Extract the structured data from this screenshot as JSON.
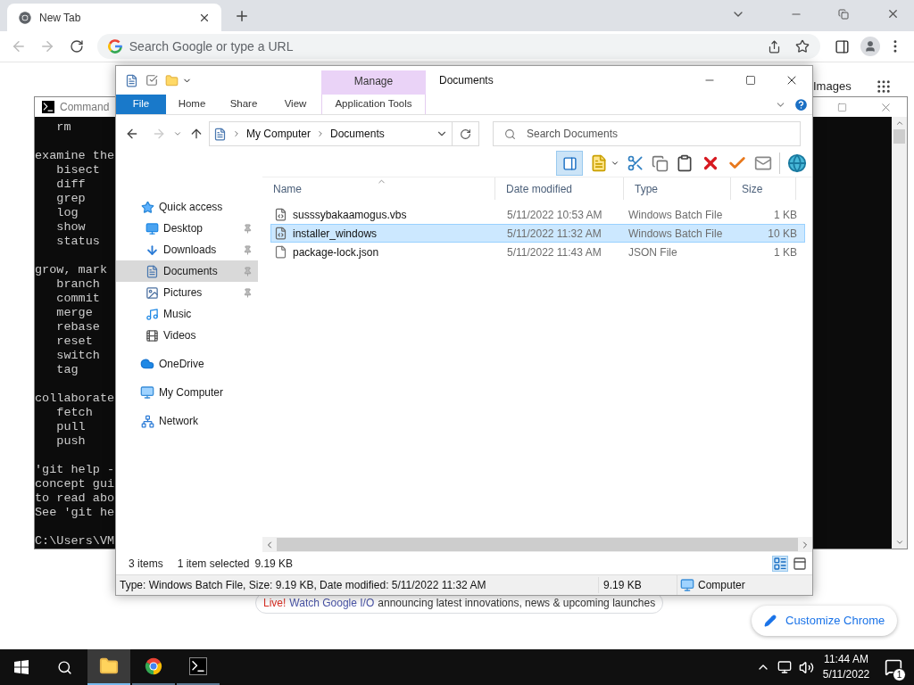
{
  "browser": {
    "tab": {
      "title": "New Tab"
    },
    "omnibox": {
      "placeholder": "Search Google or type a URL"
    },
    "page": {
      "images_link": "Images",
      "promo": {
        "live": "Live!",
        "link": "Watch Google I/O",
        "text": "announcing latest innovations, news & upcoming launches"
      },
      "customize_button": "Customize Chrome"
    }
  },
  "terminal": {
    "title": "Command",
    "blocks": [
      [
        "   rm"
      ],
      [
        "examine the",
        "   bisect",
        "   diff",
        "   grep",
        "   log",
        "   show",
        "   status"
      ],
      [
        "grow, mark",
        "   branch",
        "   commit",
        "   merge",
        "   rebase",
        "   reset",
        "   switch",
        "   tag"
      ],
      [
        "collaborate",
        "   fetch",
        "   pull",
        "   push"
      ],
      [
        "'git help -",
        "concept gui",
        "to read abo",
        "See 'git he"
      ],
      [
        "C:\\Users\\VM"
      ]
    ]
  },
  "explorer": {
    "title": "Documents",
    "context_tab": "Manage",
    "ribbon_tabs": [
      {
        "label": "File",
        "kind": "file"
      },
      {
        "label": "Home",
        "kind": "tab"
      },
      {
        "label": "Share",
        "kind": "tab"
      },
      {
        "label": "View",
        "kind": "tab"
      },
      {
        "label": "Application Tools",
        "kind": "context"
      }
    ],
    "breadcrumb": [
      "My Computer",
      "Documents"
    ],
    "search_placeholder": "Search Documents",
    "nav": [
      {
        "label": "Quick access",
        "kind": "star",
        "selected": false,
        "children": [
          {
            "label": "Desktop",
            "kind": "desktop",
            "pinned": true,
            "selected": false
          },
          {
            "label": "Downloads",
            "kind": "download",
            "pinned": true,
            "selected": false
          },
          {
            "label": "Documents",
            "kind": "document",
            "pinned": true,
            "selected": true
          },
          {
            "label": "Pictures",
            "kind": "picture",
            "pinned": true,
            "selected": false
          },
          {
            "label": "Music",
            "kind": "music",
            "pinned": false,
            "selected": false
          },
          {
            "label": "Videos",
            "kind": "video",
            "pinned": false,
            "selected": false
          }
        ]
      },
      {
        "label": "OneDrive",
        "kind": "cloud",
        "selected": false
      },
      {
        "label": "My Computer",
        "kind": "computer",
        "selected": false
      },
      {
        "label": "Network",
        "kind": "network",
        "selected": false
      }
    ],
    "columns": [
      "Name",
      "Date modified",
      "Type",
      "Size"
    ],
    "files": [
      {
        "name": "susssybakaamogus.vbs",
        "date": "5/11/2022 10:53 AM",
        "type": "Windows Batch File",
        "size": "1 KB",
        "kind": "script",
        "selected": false
      },
      {
        "name": "installer_windows",
        "date": "5/11/2022 11:32 AM",
        "type": "Windows Batch File",
        "size": "10 KB",
        "kind": "script",
        "selected": true
      },
      {
        "name": "package-lock.json",
        "date": "5/11/2022 11:43 AM",
        "type": "JSON File",
        "size": "1 KB",
        "kind": "file",
        "selected": false
      }
    ],
    "status": {
      "count": "3 items",
      "selected_label": "1 item selected",
      "selected_size": "9.19 KB"
    },
    "details_bar": {
      "text": "Type: Windows Batch File, Size: 9.19 KB, Date modified: 5/11/2022 11:32 AM",
      "size": "9.19 KB",
      "zone": "Computer"
    }
  },
  "taskbar": {
    "apps": [
      {
        "kind": "explorer",
        "selected": true
      },
      {
        "kind": "chrome",
        "selected": false
      },
      {
        "kind": "terminal",
        "selected": false
      }
    ],
    "time": "11:44 AM",
    "date": "5/11/2022",
    "notifications": "1"
  }
}
